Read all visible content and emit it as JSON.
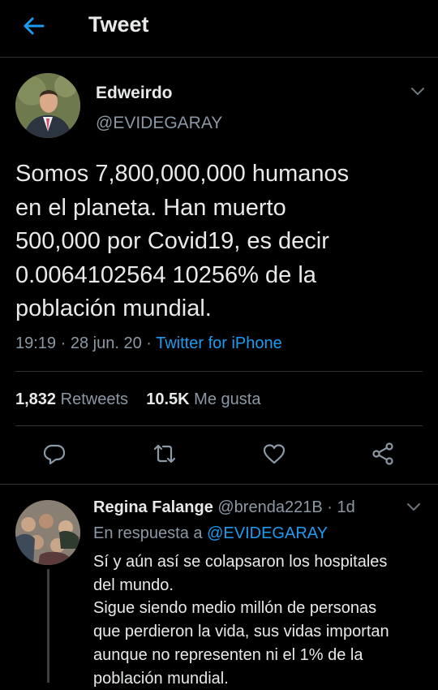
{
  "header": {
    "title": "Tweet"
  },
  "tweet": {
    "author_name": "Edweirdo",
    "author_handle": "@EVIDEGARAY",
    "text": "Somos 7,800,000,000 humanos\nen el planeta. Han muerto\n500,000 por Covid19, es decir\n0.0064102564 10256% de la\npoblación mundial.",
    "time": "19:19",
    "date": "28 jun. 20",
    "source": "Twitter for iPhone",
    "retweets_count": "1,832",
    "retweets_label": "Retweets",
    "likes_count": "10.5K",
    "likes_label": "Me gusta"
  },
  "reply": {
    "name": "Regina Falange",
    "handle": "@brenda221B",
    "age": "1d",
    "in_reply_to_label": "En respuesta a",
    "in_reply_to_handle": "@EVIDEGARAY",
    "text": "Sí y aún así se colapsaron los hospitales\ndel mundo.\nSigue siendo medio millón de personas\nque perdieron la vida, sus vidas importan\naunque no representen ni el 1% de la\npoblación mundial."
  },
  "colors": {
    "accent": "#1d9bf0",
    "background": "#000000",
    "secondary_text": "#8b98a5"
  },
  "icons": [
    "back-arrow-icon",
    "chevron-down-icon",
    "reply-icon",
    "retweet-icon",
    "like-icon",
    "share-icon"
  ]
}
